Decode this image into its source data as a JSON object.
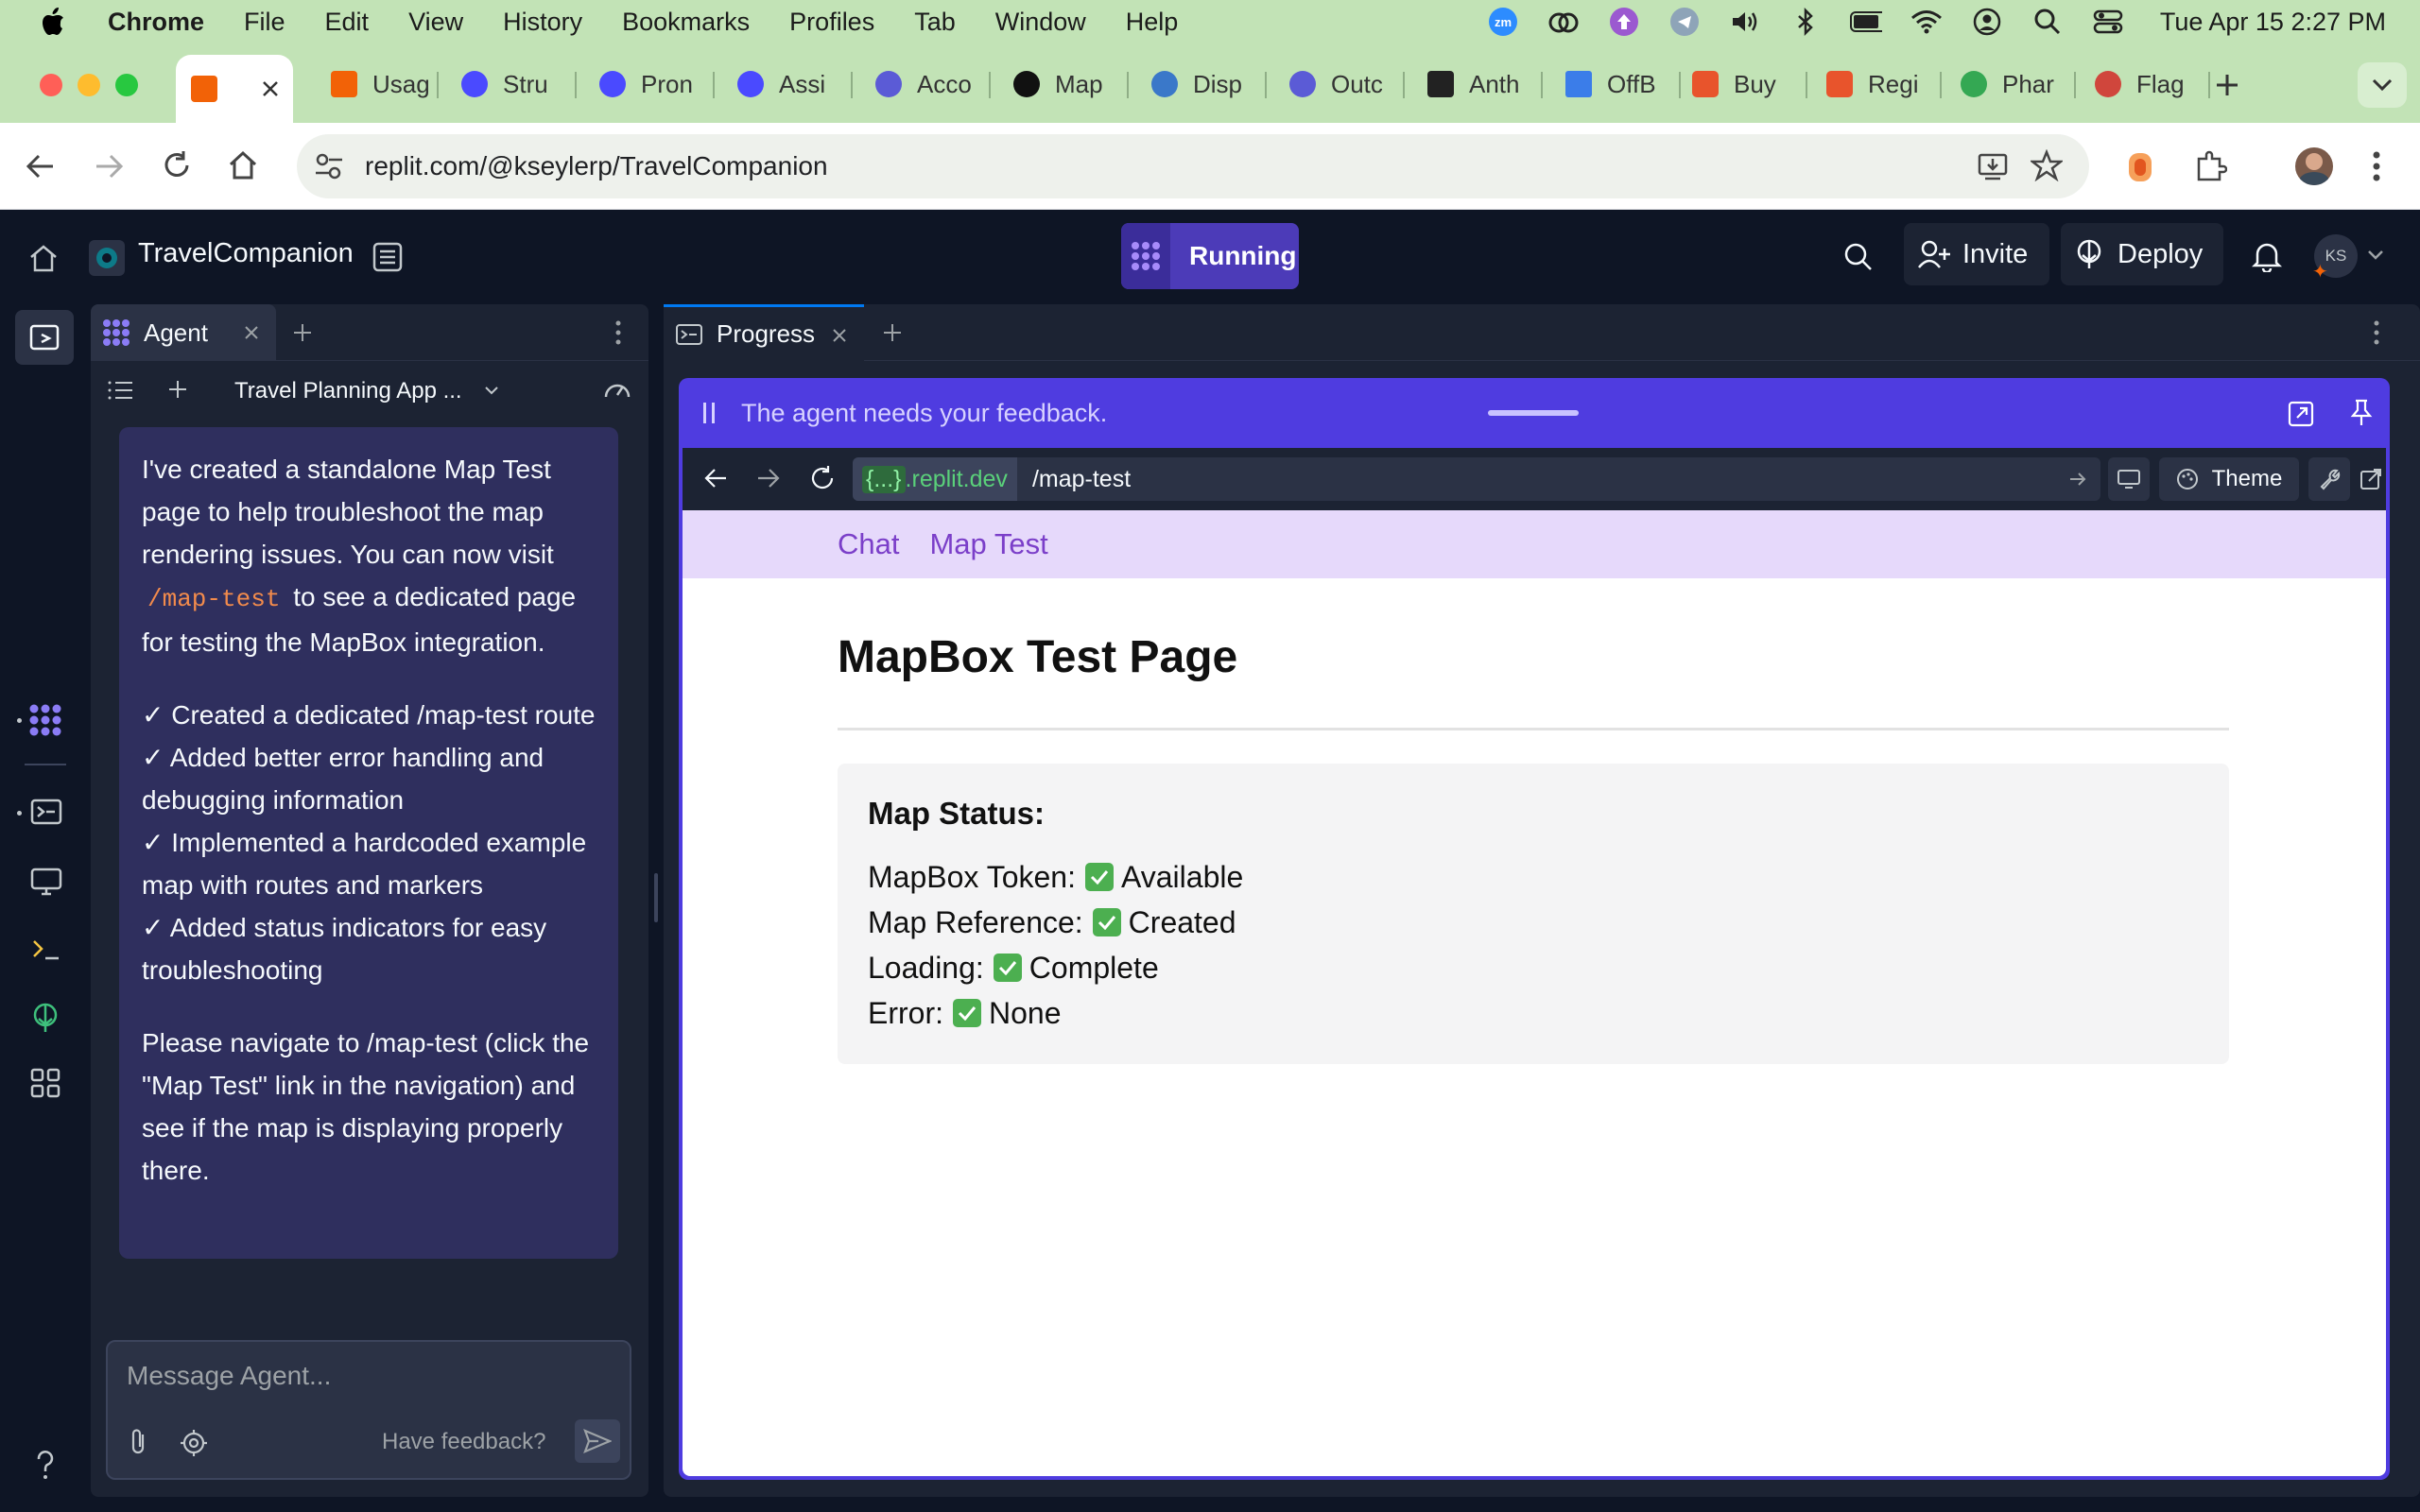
{
  "menubar": {
    "app": "Chrome",
    "items": [
      "File",
      "Edit",
      "View",
      "History",
      "Bookmarks",
      "Profiles",
      "Tab",
      "Window",
      "Help"
    ],
    "clock": "Tue Apr 15  2:27 PM",
    "status_icons": [
      "zoom-icon",
      "creative-cloud-icon",
      "upload-icon",
      "telegram-icon",
      "volume-icon",
      "bluetooth-icon",
      "battery-icon",
      "wifi-icon",
      "user-icon",
      "spotlight-icon",
      "control-center-icon"
    ]
  },
  "tabs": [
    {
      "label": "",
      "favicon_color": "#f26207",
      "active": true
    },
    {
      "label": "Usag",
      "favicon_color": "#f26207"
    },
    {
      "label": "Stru",
      "favicon_color": "#4a4aff"
    },
    {
      "label": "Pron",
      "favicon_color": "#4a4aff"
    },
    {
      "label": "Assi",
      "favicon_color": "#4a4aff"
    },
    {
      "label": "Acco",
      "favicon_color": "#5b5bd6"
    },
    {
      "label": "Map",
      "favicon_color": "#111111"
    },
    {
      "label": "Disp",
      "favicon_color": "#3a78c9"
    },
    {
      "label": "Outc",
      "favicon_color": "#5b5bd6"
    },
    {
      "label": "Anth",
      "favicon_color": "#222222"
    },
    {
      "label": "OffB",
      "favicon_color": "#3b7de9"
    },
    {
      "label": "Buy",
      "favicon_color": "#e8542c"
    },
    {
      "label": "Regi",
      "favicon_color": "#e8542c"
    },
    {
      "label": "Phar",
      "favicon_color": "#34a853"
    },
    {
      "label": "Flag",
      "favicon_color": "#d0463c"
    }
  ],
  "toolbar": {
    "url": "replit.com/@kseylerp/TravelCompanion"
  },
  "replit": {
    "project_name": "TravelCompanion",
    "run_status": "Running",
    "invite_label": "Invite",
    "deploy_label": "Deploy",
    "avatar_initials": "KS"
  },
  "agent_panel": {
    "tab_label": "Agent",
    "thread_title": "Travel Planning App ...",
    "message": {
      "intro_before": "I've created a standalone Map Test page to help troubleshoot the map rendering issues. You can now visit",
      "intro_code": "/map-test",
      "intro_after": "to see a dedicated page for testing the MapBox integration.",
      "checklist": [
        "✓ Created a dedicated /map-test route",
        "✓ Added better error handling and debugging information",
        "✓ Implemented a hardcoded example map with routes and markers",
        "✓ Added status indicators for easy troubleshooting"
      ],
      "outro": "Please navigate to /map-test (click the \"Map Test\" link in the navigation) and see if the map is displaying properly there."
    },
    "input_placeholder": "Message Agent...",
    "feedback_label": "Have feedback?"
  },
  "progress_panel": {
    "tab_label": "Progress",
    "feedback_banner": "The agent needs your feedback.",
    "webview": {
      "domain_prefix": "{...}",
      "domain": ".replit.dev",
      "path": "/map-test",
      "theme_label": "Theme"
    },
    "site": {
      "nav": [
        "Chat",
        "Map Test"
      ],
      "title": "MapBox Test Page",
      "status_heading": "Map Status:",
      "status_rows": [
        {
          "label": "MapBox Token:",
          "value": "Available"
        },
        {
          "label": "Map Reference:",
          "value": "Created"
        },
        {
          "label": "Loading:",
          "value": "Complete"
        },
        {
          "label": "Error:",
          "value": "None"
        }
      ]
    }
  },
  "colors": {
    "menubar_bg": "#c2e3b6",
    "replit_bg": "#0e1525",
    "panel_bg": "#1c2333",
    "agent_message_bg": "#2f2f5e",
    "running_purple": "#4c3bb8",
    "feedback_purple": "#4f3ce0",
    "site_nav_bg": "#e6d9fb",
    "site_link": "#7b3fc9",
    "check_green": "#4caf50"
  }
}
